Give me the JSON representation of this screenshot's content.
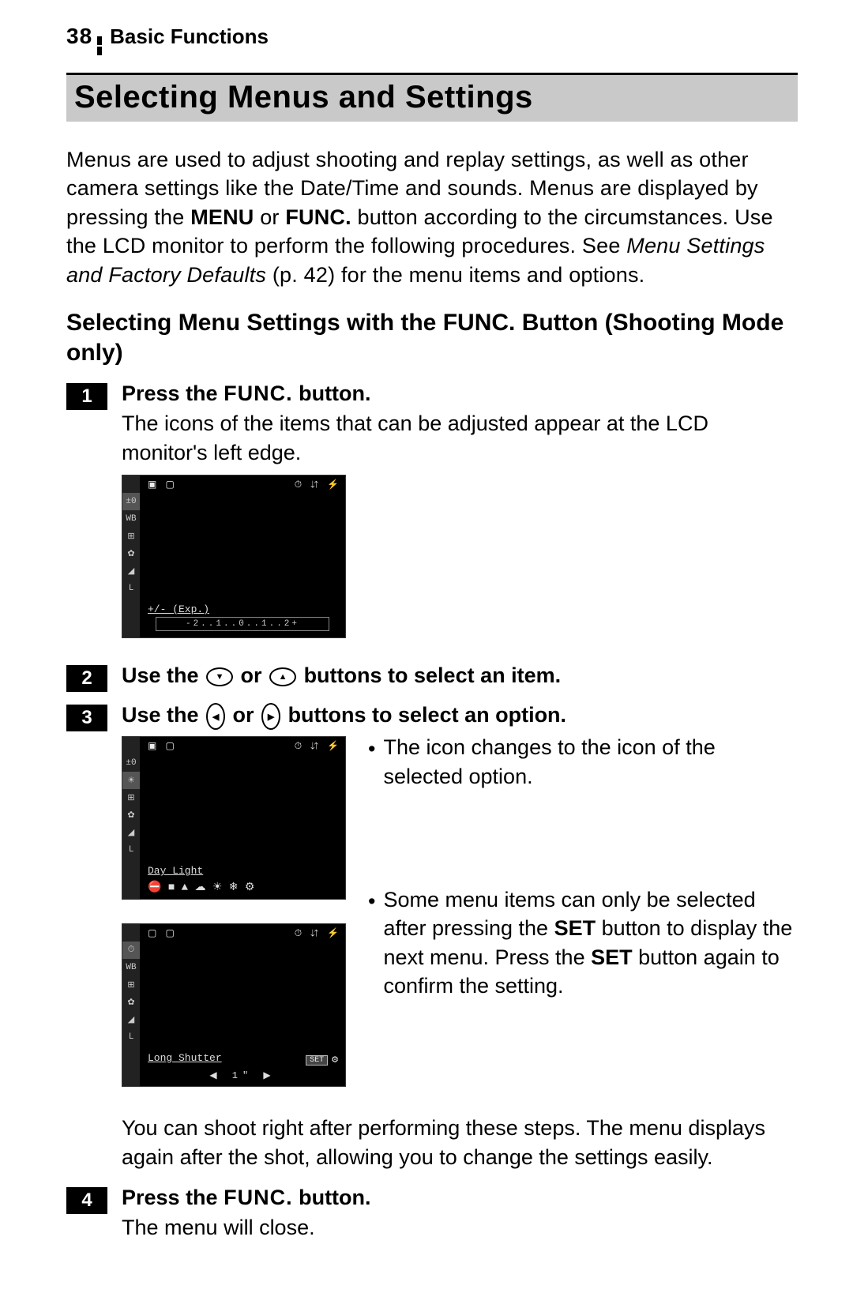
{
  "header": {
    "page_number": "38",
    "section": "Basic Functions"
  },
  "title": "Selecting Menus and Settings",
  "intro": {
    "pre": "Menus are used to adjust shooting and replay settings, as well as other camera settings like the Date/Time and sounds. Menus are displayed by pressing the ",
    "menu": "MENU",
    "or": " or ",
    "func": "FUNC.",
    "mid": " button according to the circumstances. Use the LCD monitor to perform the following procedures. See ",
    "italic": "Menu Settings and Factory Defaults",
    "tail": " (p. 42) for the menu items and options."
  },
  "subheading": "Selecting Menu Settings with the FUNC. Button (Shooting Mode only)",
  "steps": {
    "s1": {
      "num": "1",
      "title_pre": "Press the ",
      "title_func": "FUNC.",
      "title_post": " button.",
      "body": "The icons of the items that can be adjusted appear at the LCD monitor's left edge.",
      "lcd": {
        "top_left": "▣ ▢",
        "top_right": "⏱ ⇵ ⚡",
        "side": [
          "±0",
          "WB",
          "⊞",
          "✿",
          "◢",
          "L"
        ],
        "label": "+/- (Exp.)",
        "scale": "-2..1..0..1..2+"
      }
    },
    "s2": {
      "num": "2",
      "title_pre": "Use the ",
      "oval1": "▼",
      "title_mid": " or ",
      "oval2": "▲",
      "title_post": " buttons to select an item."
    },
    "s3": {
      "num": "3",
      "title_pre": "Use the ",
      "oval1": "◀",
      "title_mid": " or ",
      "oval2": "▶",
      "title_post": " buttons to select an option.",
      "lcd_a": {
        "top_left": "▣ ▢",
        "top_right": "⏱ ⇵ ⚡",
        "side": [
          "±0",
          "☀",
          "⊞",
          "✿",
          "◢",
          "L"
        ],
        "label": "Day Light",
        "icons": "⛔ ■ ▲ ☁ ☀ ❄ ⚙"
      },
      "lcd_b": {
        "top_left": "▢ ▢",
        "top_right": "⏱ ⇵ ⚡",
        "side": [
          "⏱",
          "WB",
          "⊞",
          "✿",
          "◢",
          "L"
        ],
        "label": "Long Shutter",
        "set": "SET",
        "seticon": "⚙",
        "arrows": "◀ 1\" ▶"
      },
      "bullet1": "The icon changes to the icon of the selected option.",
      "bullet2_pre": "Some menu items can only be selected after pressing the ",
      "bullet2_set": "SET",
      "bullet2_mid": " button to display the next menu. Press the ",
      "bullet2_set2": "SET",
      "bullet2_post": " button again to confirm the setting."
    },
    "closing": "You can shoot right after performing these steps. The menu displays again after the shot, allowing you to change the settings easily.",
    "s4": {
      "num": "4",
      "title_pre": "Press the ",
      "title_func": "FUNC.",
      "title_post": " button.",
      "body": "The menu will close."
    }
  }
}
